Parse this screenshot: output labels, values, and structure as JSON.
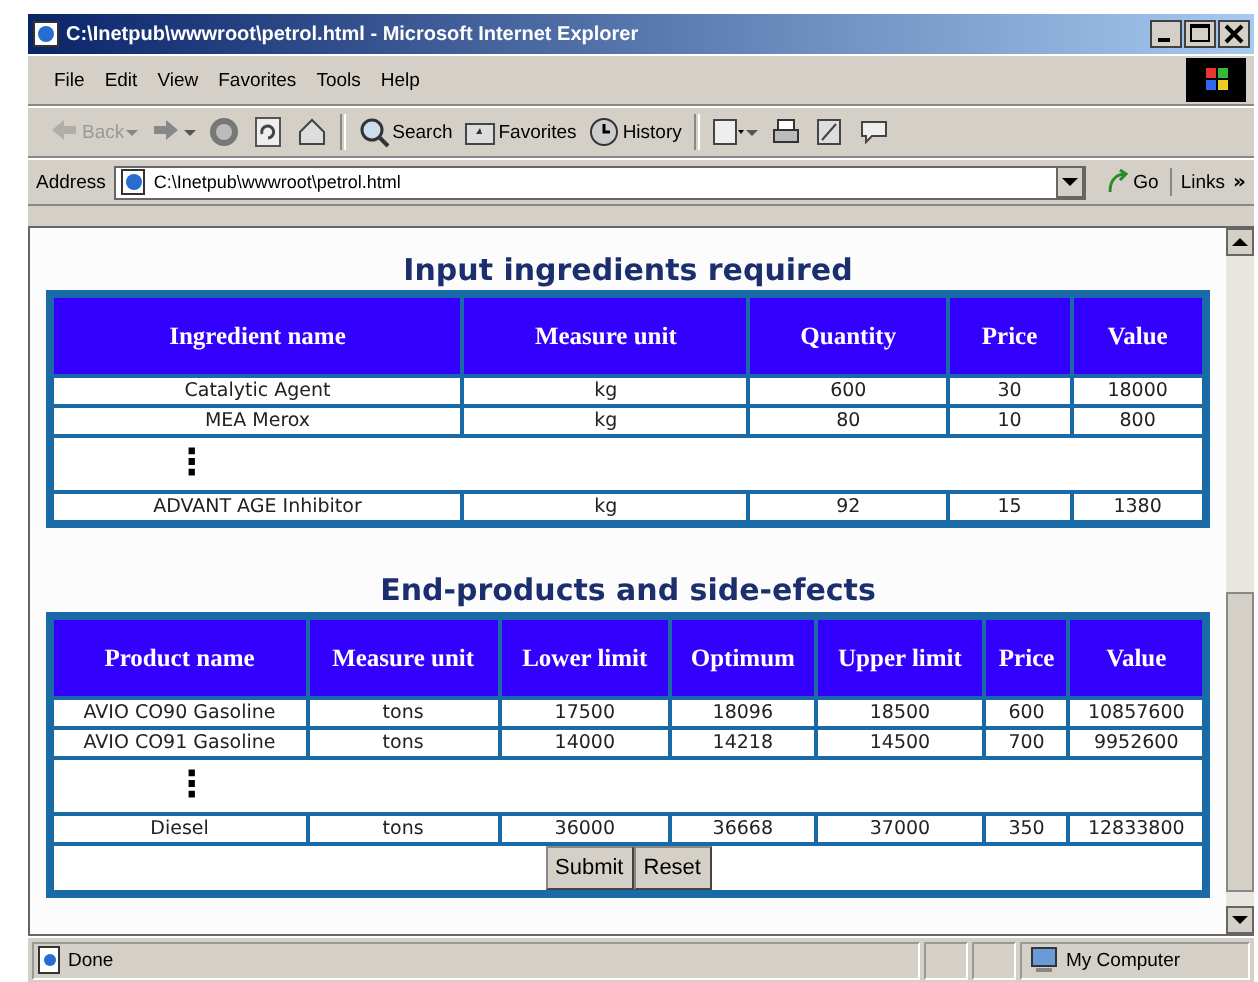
{
  "window": {
    "title": "C:\\Inetpub\\wwwroot\\petrol.html - Microsoft Internet Explorer"
  },
  "menu": [
    "File",
    "Edit",
    "View",
    "Favorites",
    "Tools",
    "Help"
  ],
  "toolbar": [
    {
      "kind": "back",
      "label": "Back",
      "disabled": true
    },
    {
      "kind": "forward"
    },
    {
      "kind": "stop"
    },
    {
      "kind": "refresh"
    },
    {
      "kind": "home"
    },
    {
      "kind": "search",
      "label": "Search",
      "disabled": false
    },
    {
      "kind": "favorites",
      "label": "Favorites",
      "disabled": false
    },
    {
      "kind": "history",
      "label": "History",
      "disabled": false
    },
    {
      "kind": "mail"
    },
    {
      "kind": "print"
    },
    {
      "kind": "edit"
    },
    {
      "kind": "discuss"
    }
  ],
  "address": {
    "label": "Address",
    "value": "C:\\Inetpub\\wwwroot\\petrol.html",
    "go": "Go",
    "links": "Links",
    "more": "»"
  },
  "sections": [
    {
      "title": "Input ingredients required",
      "columns": [
        "Ingredient name",
        "Measure unit",
        "Quantity",
        "Price",
        "Value"
      ],
      "rows": [
        {
          "kind": "data",
          "cells": [
            "Catalytic Agent",
            "kg",
            "600",
            "30",
            "18000"
          ]
        },
        {
          "kind": "data",
          "cells": [
            "MEA Merox",
            "kg",
            "80",
            "10",
            "800"
          ]
        },
        {
          "kind": "ellipsis",
          "text": "⋮"
        },
        {
          "kind": "data",
          "cells": [
            "ADVANT AGE Inhibitor",
            "kg",
            "92",
            "15",
            "1380"
          ]
        }
      ]
    },
    {
      "title": "End-products and side-efects",
      "columns": [
        "Product name",
        "Measure unit",
        "Lower limit",
        "Optimum",
        "Upper limit",
        "Price",
        "Value"
      ],
      "rows": [
        {
          "kind": "data",
          "cells": [
            "AVIO CO90 Gasoline",
            "tons",
            "17500",
            "18096",
            "18500",
            "600",
            "10857600"
          ]
        },
        {
          "kind": "data",
          "cells": [
            "AVIO CO91 Gasoline",
            "tons",
            "14000",
            "14218",
            "14500",
            "700",
            "9952600"
          ]
        },
        {
          "kind": "ellipsis",
          "text": "⋮"
        },
        {
          "kind": "data",
          "cells": [
            "Diesel",
            "tons",
            "36000",
            "36668",
            "37000",
            "350",
            "12833800"
          ]
        }
      ],
      "buttons": [
        "Submit",
        "Reset"
      ]
    }
  ],
  "status_bar": {
    "text": "Done",
    "zone": "My Computer"
  }
}
